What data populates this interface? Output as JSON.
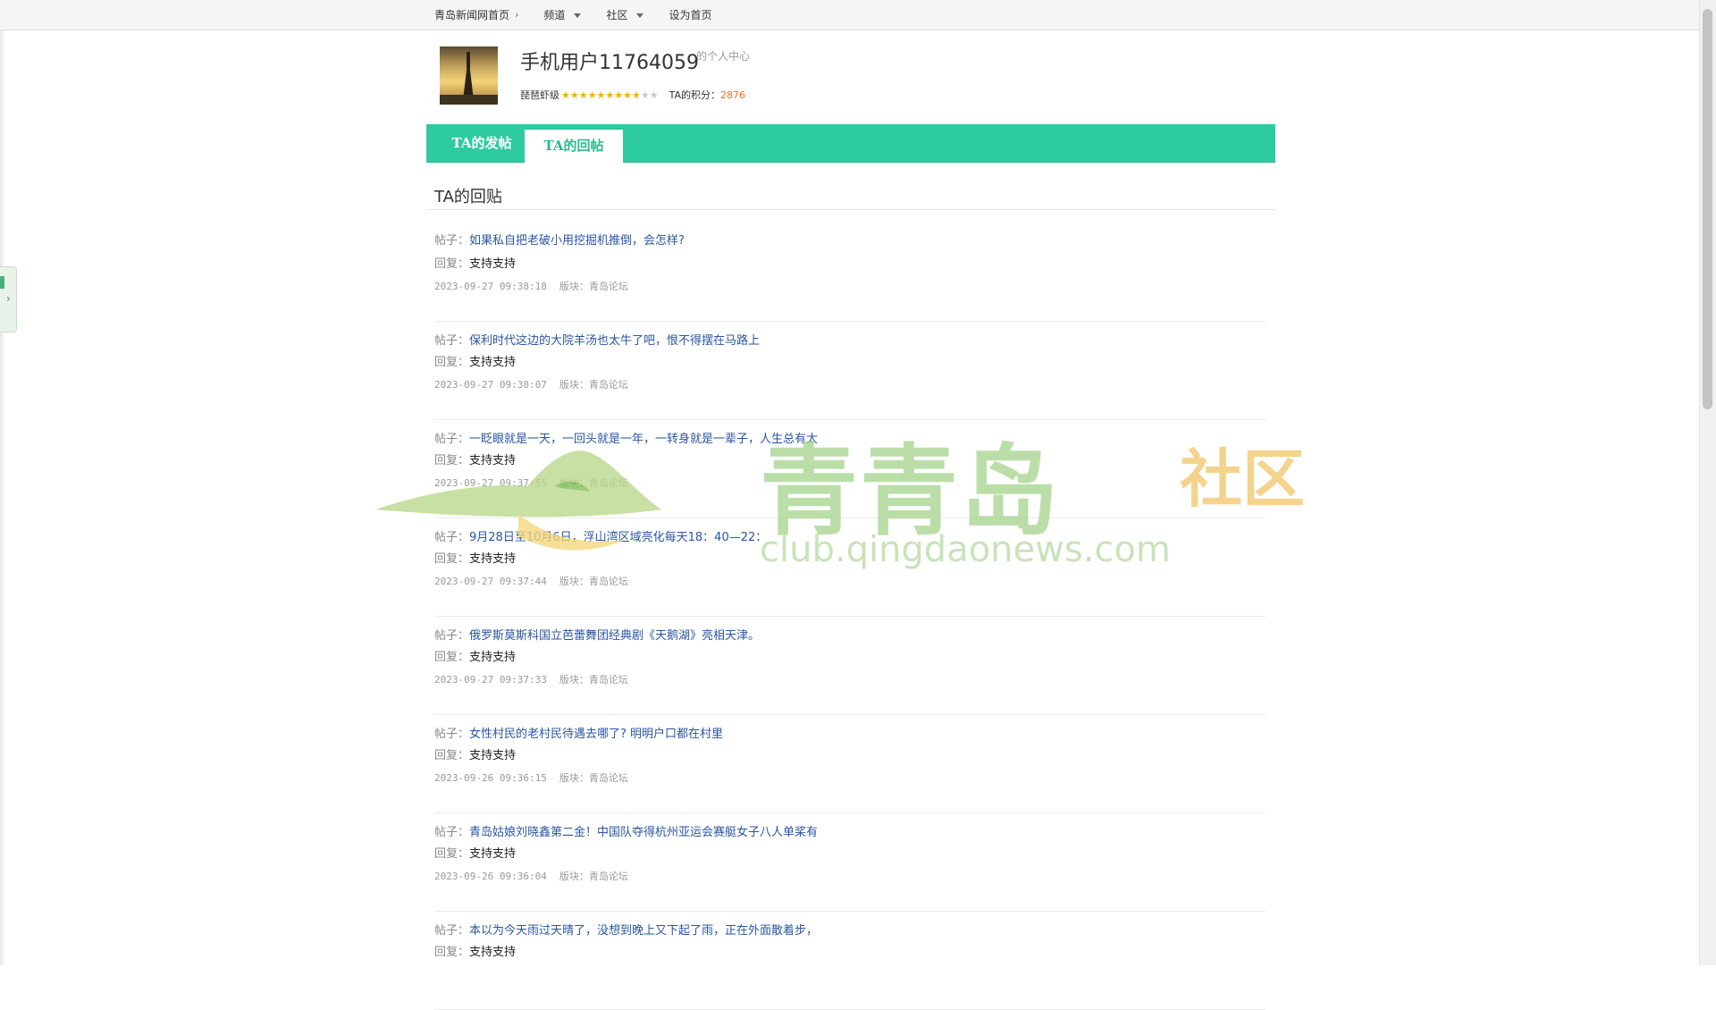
{
  "topnav": {
    "home": "青岛新闻网首页",
    "channel": "频道",
    "community": "社区",
    "set_home": "设为首页"
  },
  "profile": {
    "username": "手机用户11764059",
    "suffix": "的个人中心",
    "level_label": "琵琶虾级",
    "stars_filled": 9,
    "stars_total": 11,
    "score_label": "TA的积分：",
    "score": "2876"
  },
  "tabs": {
    "posts": "TA的发帖",
    "replies": "TA的回帖",
    "active": "replies"
  },
  "section": {
    "title": "TA的回贴"
  },
  "labels": {
    "post": "帖子：",
    "reply": "回复：",
    "board": "版块："
  },
  "posts": [
    {
      "title": "如果私自把老破小用挖掘机推倒，会怎样?",
      "reply": "支持支持",
      "time": "2023-09-27 09:38:18",
      "board": "青岛论坛"
    },
    {
      "title": "保利时代这边的大院羊汤也太牛了吧，恨不得摆在马路上",
      "reply": "支持支持",
      "time": "2023-09-27 09:38:07",
      "board": "青岛论坛"
    },
    {
      "title": "一眨眼就是一天，一回头就是一年，一转身就是一辈子，人生总有太",
      "reply": "支持支持",
      "time": "2023-09-27 09:37:55",
      "board": "青岛论坛"
    },
    {
      "title": "9月28日至10月6日，浮山湾区域亮化每天18：40—22：",
      "reply": "支持支持",
      "time": "2023-09-27 09:37:44",
      "board": "青岛论坛"
    },
    {
      "title": "俄罗斯莫斯科国立芭蕾舞团经典剧《天鹅湖》亮相天津。",
      "reply": "支持支持",
      "time": "2023-09-27 09:37:33",
      "board": "青岛论坛"
    },
    {
      "title": "女性村民的老村民待遇去哪了? 明明户口都在村里",
      "reply": "支持支持",
      "time": "2023-09-26 09:36:15",
      "board": "青岛论坛"
    },
    {
      "title": "青岛姑娘刘晓鑫第二金！中国队夺得杭州亚运会赛艇女子八人单桨有",
      "reply": "支持支持",
      "time": "2023-09-26 09:36:04",
      "board": "青岛论坛"
    },
    {
      "title": "本以为今天雨过天晴了，没想到晚上又下起了雨，正在外面散着步，",
      "reply": "支持支持",
      "time": "",
      "board": ""
    }
  ],
  "watermark": {
    "brand": "青青岛",
    "sub": "社区",
    "url": "club.qingdaonews.com"
  },
  "colors": {
    "tab_bar": "#2ecba0",
    "link": "#2a55a2",
    "score": "#f26b21",
    "star": "#f0b400"
  }
}
